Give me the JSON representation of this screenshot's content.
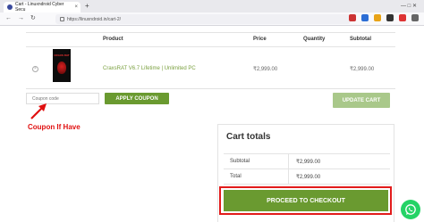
{
  "browser": {
    "tab_title": "Cart - Linuxndroid Cyber Secu",
    "tab_close": "×",
    "new_tab": "+",
    "url": "https://linuxndroid.in/cart-2/",
    "window_controls": "—  □  ✕",
    "back": "←",
    "forward": "→",
    "reload": "↻"
  },
  "cart": {
    "headers": {
      "product": "Product",
      "price": "Price",
      "quantity": "Quantity",
      "subtotal": "Subtotal"
    },
    "items": [
      {
        "remove": "×",
        "thumb_title": "CRAXS RAT",
        "name": "CraxsRAT V6.7 Lifetime | Unlimited PC",
        "price": "₹2,999.00",
        "subtotal": "₹2,999.00"
      }
    ]
  },
  "coupon": {
    "placeholder": "Coupon code",
    "apply_label": "APPLY COUPON",
    "update_label": "UPDATE CART",
    "annotation": "Coupon If Have"
  },
  "totals": {
    "title": "Cart totals",
    "rows": [
      {
        "label": "Subtotal",
        "value": "₹2,999.00"
      },
      {
        "label": "Total",
        "value": "₹2,999.00"
      }
    ],
    "checkout_label": "PROCEED TO CHECKOUT"
  },
  "colors": {
    "accent_green": "#6a9a30",
    "annotation_red": "#e01010",
    "whatsapp": "#25d366"
  },
  "icons": {
    "floating": "whatsapp-icon"
  }
}
